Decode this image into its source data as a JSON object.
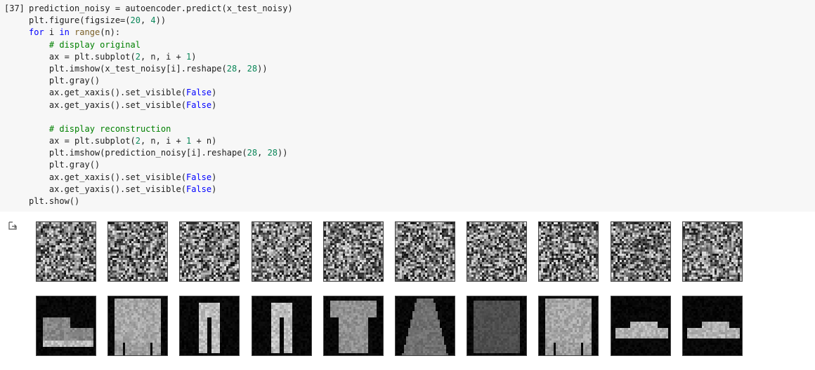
{
  "cell": {
    "execution_count": "[37]",
    "code_lines": [
      [
        {
          "t": "prediction_noisy = autoencoder.predict(x_test_noisy)",
          "c": ""
        }
      ],
      [
        {
          "t": "plt.figure(figsize=(",
          "c": ""
        },
        {
          "t": "20",
          "c": "num"
        },
        {
          "t": ", ",
          "c": ""
        },
        {
          "t": "4",
          "c": "num"
        },
        {
          "t": "))",
          "c": ""
        }
      ],
      [
        {
          "t": "for",
          "c": "kw"
        },
        {
          "t": " i ",
          "c": ""
        },
        {
          "t": "in",
          "c": "kw"
        },
        {
          "t": " ",
          "c": ""
        },
        {
          "t": "range",
          "c": "bi"
        },
        {
          "t": "(n):",
          "c": ""
        }
      ],
      [
        {
          "t": "    ",
          "c": ""
        },
        {
          "t": "# display original",
          "c": "cm"
        }
      ],
      [
        {
          "t": "    ax = plt.subplot(",
          "c": ""
        },
        {
          "t": "2",
          "c": "num"
        },
        {
          "t": ", n, i + ",
          "c": ""
        },
        {
          "t": "1",
          "c": "num"
        },
        {
          "t": ")",
          "c": ""
        }
      ],
      [
        {
          "t": "    plt.imshow(x_test_noisy[i].reshape(",
          "c": ""
        },
        {
          "t": "28",
          "c": "num"
        },
        {
          "t": ", ",
          "c": ""
        },
        {
          "t": "28",
          "c": "num"
        },
        {
          "t": "))",
          "c": ""
        }
      ],
      [
        {
          "t": "    plt.gray()",
          "c": ""
        }
      ],
      [
        {
          "t": "    ax.get_xaxis().set_visible(",
          "c": ""
        },
        {
          "t": "False",
          "c": "cst"
        },
        {
          "t": ")",
          "c": ""
        }
      ],
      [
        {
          "t": "    ax.get_yaxis().set_visible(",
          "c": ""
        },
        {
          "t": "False",
          "c": "cst"
        },
        {
          "t": ")",
          "c": ""
        }
      ],
      [
        {
          "t": "",
          "c": ""
        }
      ],
      [
        {
          "t": "    ",
          "c": ""
        },
        {
          "t": "# display reconstruction",
          "c": "cm"
        }
      ],
      [
        {
          "t": "    ax = plt.subplot(",
          "c": ""
        },
        {
          "t": "2",
          "c": "num"
        },
        {
          "t": ", n, i + ",
          "c": ""
        },
        {
          "t": "1",
          "c": "num"
        },
        {
          "t": " + n)",
          "c": ""
        }
      ],
      [
        {
          "t": "    plt.imshow(prediction_noisy[i].reshape(",
          "c": ""
        },
        {
          "t": "28",
          "c": "num"
        },
        {
          "t": ", ",
          "c": ""
        },
        {
          "t": "28",
          "c": "num"
        },
        {
          "t": "))",
          "c": ""
        }
      ],
      [
        {
          "t": "    plt.gray()",
          "c": ""
        }
      ],
      [
        {
          "t": "    ax.get_xaxis().set_visible(",
          "c": ""
        },
        {
          "t": "False",
          "c": "cst"
        },
        {
          "t": ")",
          "c": ""
        }
      ],
      [
        {
          "t": "    ax.get_yaxis().set_visible(",
          "c": ""
        },
        {
          "t": "False",
          "c": "cst"
        },
        {
          "t": ")",
          "c": ""
        }
      ],
      [
        {
          "t": "plt.show()",
          "c": ""
        }
      ]
    ]
  },
  "output": {
    "icon": "output-redirect-icon",
    "rows": [
      {
        "name": "noisy-input",
        "panels": [
          "noise",
          "noise",
          "noise",
          "noise",
          "noise",
          "noise",
          "noise",
          "noise",
          "noise",
          "noise"
        ]
      },
      {
        "name": "reconstruction",
        "panels": [
          "shoe",
          "sweater",
          "trousers",
          "trousers",
          "tshirt",
          "dress",
          "pullover",
          "sweater",
          "sneaker",
          "sneaker"
        ]
      }
    ]
  },
  "colors": {
    "code_bg": "#f7f7f7",
    "keyword": "#0000ff",
    "number": "#098658",
    "comment": "#008000",
    "builtin": "#795e26"
  }
}
